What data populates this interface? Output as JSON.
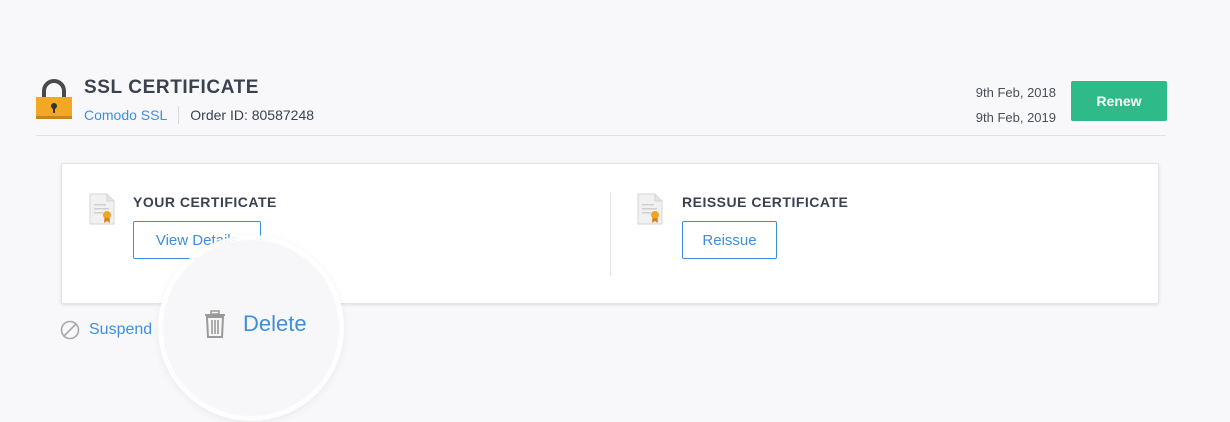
{
  "header": {
    "title": "SSL CERTIFICATE",
    "provider": "Comodo SSL",
    "order_id": "Order ID: 80587248",
    "date_start": "9th Feb, 2018",
    "date_end": "9th Feb, 2019",
    "renew_label": "Renew"
  },
  "card": {
    "left": {
      "title": "YOUR CERTIFICATE",
      "button": "View Details",
      "icon": "certificate-document-icon"
    },
    "right": {
      "title": "REISSUE CERTIFICATE",
      "button": "Reissue",
      "icon": "certificate-document-icon"
    }
  },
  "actions": {
    "suspend_label": "Suspend",
    "delete_label": "Delete"
  },
  "colors": {
    "accent": "#3d8ee0",
    "renew": "#2fba8a",
    "lock": "#f2a825"
  }
}
